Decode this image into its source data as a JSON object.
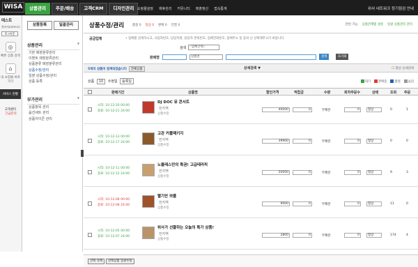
{
  "header": {
    "logo": "WISA",
    "tabs": [
      {
        "label": "상품관리",
        "active": true
      },
      {
        "label": "주문/배송",
        "active": false
      },
      {
        "label": "고객CRM",
        "active": false
      },
      {
        "label": "디자인관리",
        "active": false
      }
    ],
    "menu": [
      "쇼핑몰설정",
      "제휴관리",
      "커뮤니티",
      "매출정산",
      "접속통계"
    ],
    "right": "위사 네트워크 정기점검 안내"
  },
  "side": {
    "user": "테스트",
    "user_id": "관리자(admin)",
    "logout": "로그아웃",
    "quick": [
      {
        "icon": "◎",
        "label": "빠른 상품 검색"
      },
      {
        "icon": "⌂",
        "label": "내 쇼핑몰 바로가기"
      },
      {
        "icon": "",
        "label": "서비스 현황"
      }
    ],
    "link": "고객센터",
    "link_sub": "긴급문의"
  },
  "menu": {
    "btn1": "상품등록",
    "btn2": "일괄관리",
    "sections": [
      {
        "title": "상품관리",
        "items": [
          "기본 매장분류관리",
          "이벤트 매장분류관리",
          "상품분류 매장분류관리",
          "상품수정/관리",
          "일괄 상품수정/관리",
          "상품 등록"
        ],
        "active": 3
      },
      {
        "title": "부가관리",
        "items": [
          "상품항목 관리",
          "옵션세트 관리",
          "상품아이콘 관리"
        ],
        "active": -1
      }
    ]
  },
  "page": {
    "title": "상품수정/관리",
    "steps": [
      "품절 0",
      "정상 0",
      "판매 0",
      "진열 0"
    ],
    "options": [
      "관련 가능",
      "상품관계탭 설정",
      "일괄 상품관리 관리"
    ],
    "supplier_label": "공급업체",
    "note": "• 업체를 검색하시고, 사업자번호, 담당자명, 담당자 연락번호, 업체전화번호, 업체주소 등 등의 난 선택해주시기 바랍니다.",
    "type_label": "검색",
    "type_value": "::업체선택::",
    "sales_label": "판매형",
    "name_select": "상품명",
    "search_btn": "검색",
    "reset_btn": "초기화",
    "search_result": "5개의 상품이 검색되었습니다",
    "search_tag": "전체상품",
    "detail_search": "상세검색",
    "detail_right": "항상 상세검색",
    "per_page_label": "상품",
    "per_page": "10",
    "per_page_suffix": "수정일",
    "sort": "등록일",
    "legend": [
      {
        "label": "대기",
        "color": "#3aa342"
      },
      {
        "label": "판매중",
        "color": "#e03c3c"
      },
      {
        "label": "품절",
        "color": "#2060b0"
      },
      {
        "label": "숨김",
        "color": "#999999"
      }
    ],
    "columns": [
      "판매기간",
      "상품명",
      "할인가격",
      "적립금",
      "수량",
      "회차주문수",
      "상태",
      "조회",
      "주문"
    ]
  },
  "products": [
    {
      "start": "시작: 10-12-20 00:00",
      "end": "종료: 10-12-21 24:00",
      "expired": false,
      "name": "DJ DOC 뮤 콘서트",
      "seller": "전지역",
      "desc": "상품수정",
      "thumb": "#c0392b",
      "price": "40000",
      "points": "0",
      "qty": "무제한",
      "order": "0",
      "status": "정상",
      "views": "0",
      "orders": "1"
    },
    {
      "start": "시작: 10-12-13 00:00",
      "end": "종료: 10-12-17 24:00",
      "expired": false,
      "name": "고관 커플패키지",
      "seller": "전지역",
      "desc": "상품수정",
      "thumb": "#8b5a2b",
      "price": "39900",
      "points": "0",
      "qty": "무제한",
      "order": "0",
      "status": "정상",
      "views": "0",
      "orders": "0"
    },
    {
      "start": "시작: 10-12-11 00:00",
      "end": "종료: 10-12-12 24:00",
      "expired": false,
      "name": "노블레스만의 특권! 고급테라피",
      "seller": "전지역",
      "desc": "상품수정",
      "thumb": "#c8a070",
      "price": "50000",
      "points": "0",
      "qty": "무제한",
      "order": "0",
      "status": "정상",
      "views": "9",
      "orders": "3"
    },
    {
      "start": "시작: 10-12-08 00:00",
      "end": "종료: 10-12-08 24:00",
      "expired": true,
      "name": "빨기만 와플",
      "seller": "전지역",
      "desc": "상품수정",
      "thumb": "#a0522d",
      "price": "9000",
      "points": "0",
      "qty": "무제한",
      "order": "0",
      "status": "정상",
      "views": "11",
      "orders": "0"
    },
    {
      "start": "시작: 10-12-05 00:00",
      "end": "종료: 10-12-07 24:00",
      "expired": false,
      "name": "위사가 선물하는 오늘의 특가 상품!",
      "seller": "전지역",
      "desc": "상품수정",
      "thumb": "#b9936a",
      "price": "2800",
      "points": "0",
      "qty": "무제한",
      "order": "0",
      "status": "정상",
      "views": "174",
      "orders": "4"
    }
  ],
  "bottom": {
    "btn1": "선택 삭제",
    "btn2": "선택상품 일괄수정"
  }
}
